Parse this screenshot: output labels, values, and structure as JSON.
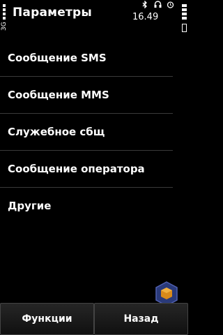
{
  "header": {
    "title": "Параметры",
    "time": "16.49",
    "status_icons": [
      "bluetooth-icon",
      "headset-icon",
      "alarm-icon"
    ],
    "network_indicator": "3G"
  },
  "menu": {
    "items": [
      {
        "label": "Сообщение SMS"
      },
      {
        "label": "Сообщение MMS"
      },
      {
        "label": "Служебное сбщ"
      },
      {
        "label": "Сообщение оператора"
      },
      {
        "label": "Другие"
      }
    ]
  },
  "softkeys": {
    "left_label": "Функции",
    "right_label": "Назад"
  },
  "colors": {
    "background": "#000000",
    "text": "#ffffff",
    "separator": "#3a3a3a",
    "logo_accent": "#d98a1a"
  }
}
